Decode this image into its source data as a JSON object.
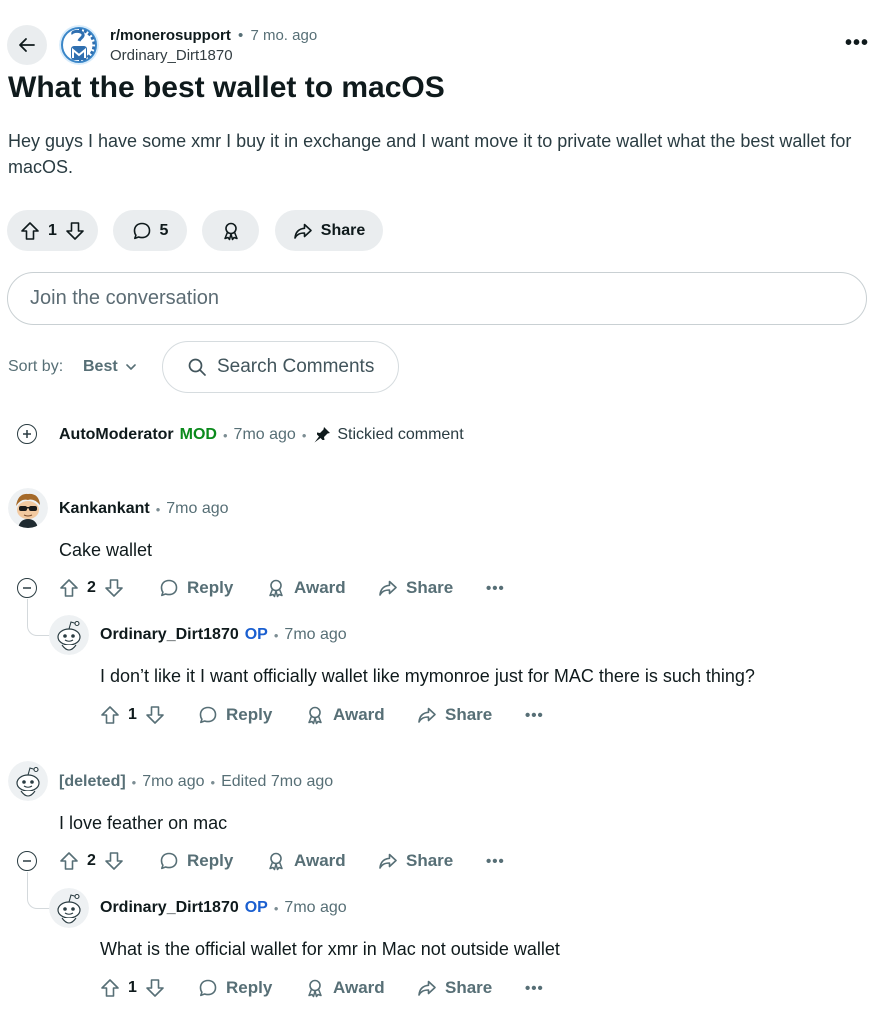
{
  "header": {
    "subreddit": "r/monerosupport",
    "age": "7 mo. ago",
    "author": "Ordinary_Dirt1870",
    "more": "•••"
  },
  "post": {
    "title": "What the best wallet to macOS",
    "body": "Hey guys I have some xmr I buy it in exchange and I want move it to private wallet what the best wallet for macOS.",
    "votes": "1",
    "comments": "5",
    "share_label": "Share"
  },
  "join": {
    "placeholder": "Join the conversation"
  },
  "sort": {
    "label": "Sort by:",
    "value": "Best"
  },
  "search": {
    "placeholder": "Search Comments"
  },
  "comments": [
    {
      "author": "AutoModerator",
      "badge": "MOD",
      "time": "7mo ago",
      "extra": "Stickied comment"
    },
    {
      "author": "Kankankant",
      "time": "7mo ago",
      "text": "Cake wallet",
      "votes": "2",
      "actions": {
        "reply": "Reply",
        "award": "Award",
        "share": "Share",
        "more": "•••"
      }
    },
    {
      "author": "Ordinary_Dirt1870",
      "badge": "OP",
      "time": "7mo ago",
      "text": "I don’t like it I want officially wallet like mymonroe just for MAC there is such thing?",
      "votes": "1",
      "actions": {
        "reply": "Reply",
        "award": "Award",
        "share": "Share",
        "more": "•••"
      }
    },
    {
      "author": "[deleted]",
      "time": "7mo ago",
      "edited": "Edited 7mo ago",
      "text": "I love feather on mac",
      "votes": "2",
      "actions": {
        "reply": "Reply",
        "award": "Award",
        "share": "Share",
        "more": "•••"
      }
    },
    {
      "author": "Ordinary_Dirt1870",
      "badge": "OP",
      "time": "7mo ago",
      "text": "What is the official wallet for xmr in Mac not outside wallet",
      "votes": "1",
      "actions": {
        "reply": "Reply",
        "award": "Award",
        "share": "Share",
        "more": "•••"
      }
    }
  ],
  "colors": {
    "accent": "#1a5fd0",
    "mod": "#0b8a1c",
    "pill": "#eaedef",
    "muted": "#576f76"
  }
}
